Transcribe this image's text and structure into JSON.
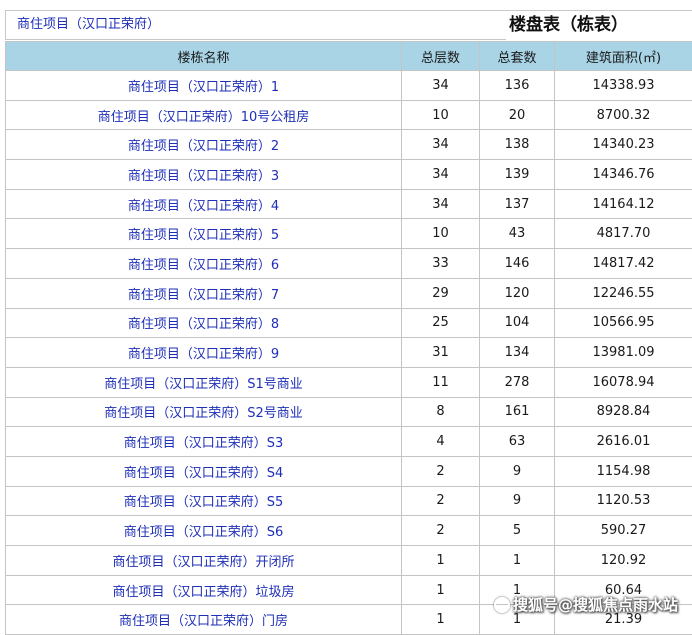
{
  "header": {
    "project_name": "商住项目（汉口正荣府）",
    "table_title": "楼盘表（栋表）"
  },
  "table": {
    "columns": [
      "楼栋名称",
      "总层数",
      "总套数",
      "建筑面积(㎡)"
    ],
    "rows": [
      [
        "商住项目（汉口正荣府）1",
        "34",
        "136",
        "14338.93"
      ],
      [
        "商住项目（汉口正荣府）10号公租房",
        "10",
        "20",
        "8700.32"
      ],
      [
        "商住项目（汉口正荣府）2",
        "34",
        "138",
        "14340.23"
      ],
      [
        "商住项目（汉口正荣府）3",
        "34",
        "139",
        "14346.76"
      ],
      [
        "商住项目（汉口正荣府）4",
        "34",
        "137",
        "14164.12"
      ],
      [
        "商住项目（汉口正荣府）5",
        "10",
        "43",
        "4817.70"
      ],
      [
        "商住项目（汉口正荣府）6",
        "33",
        "146",
        "14817.42"
      ],
      [
        "商住项目（汉口正荣府）7",
        "29",
        "120",
        "12246.55"
      ],
      [
        "商住项目（汉口正荣府）8",
        "25",
        "104",
        "10566.95"
      ],
      [
        "商住项目（汉口正荣府）9",
        "31",
        "134",
        "13981.09"
      ],
      [
        "商住项目（汉口正荣府）S1号商业",
        "11",
        "278",
        "16078.94"
      ],
      [
        "商住项目（汉口正荣府）S2号商业",
        "8",
        "161",
        "8928.84"
      ],
      [
        "商住项目（汉口正荣府）S3",
        "4",
        "63",
        "2616.01"
      ],
      [
        "商住项目（汉口正荣府）S4",
        "2",
        "9",
        "1154.98"
      ],
      [
        "商住项目（汉口正荣府）S5",
        "2",
        "9",
        "1120.53"
      ],
      [
        "商住项目（汉口正荣府）S6",
        "2",
        "5",
        "590.27"
      ],
      [
        "商住项目（汉口正荣府）开闭所",
        "1",
        "1",
        "120.92"
      ],
      [
        "商住项目（汉口正荣府）垃圾房",
        "1",
        "1",
        "60.64"
      ],
      [
        "商住项目（汉口正荣府）门房",
        "1",
        "1",
        "21.39"
      ]
    ]
  },
  "watermark": {
    "text": "搜狐号@搜狐焦点雨水站"
  },
  "colors": {
    "header_bg": "#a9d4e6",
    "link_blue": "#1f2fb8",
    "border": "#c4c4c4"
  }
}
